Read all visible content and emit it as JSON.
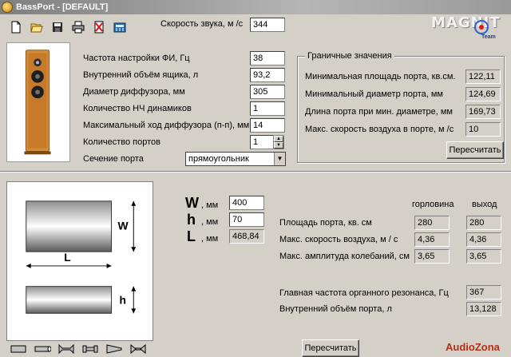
{
  "window": {
    "title": "BassPort - [DEFAULT]"
  },
  "brand": {
    "logo_text": "MAGNIT",
    "logo_sub": "Team"
  },
  "toolbar": {
    "icons": [
      "new-file-icon",
      "open-folder-icon",
      "save-icon",
      "print-icon",
      "delete-icon",
      "calculator-icon"
    ]
  },
  "sound_speed": {
    "label": "Скорость звука, м /с",
    "value": "344"
  },
  "params": [
    {
      "label": "Частота настройки ФИ, Гц",
      "value": "38"
    },
    {
      "label": "Внутренний объём ящика, л",
      "value": "93,2"
    },
    {
      "label": "Диаметр диффузора, мм",
      "value": "305"
    },
    {
      "label": "Количество НЧ динамиков",
      "value": "1"
    },
    {
      "label": "Максимальный ход диффузора (п-п), мм",
      "value": "14"
    },
    {
      "label": "Количество портов",
      "value": "1"
    }
  ],
  "port_section": {
    "label": "Сечение порта",
    "value": "прямоугольник"
  },
  "limits": {
    "title": "Граничные значения",
    "rows": [
      {
        "label": "Минимальная площадь порта, кв.см.",
        "value": "122,11"
      },
      {
        "label": "Минимальный диаметр порта, мм",
        "value": "124,69"
      },
      {
        "label": "Длина порта при мин. диаметре, мм",
        "value": "169,73"
      },
      {
        "label": "Макс. скорость воздуха в порте, м /с",
        "value": "10"
      }
    ],
    "recalc_label": "Пересчитать"
  },
  "dimensions": {
    "w": {
      "symbol": "W",
      "unit": ", мм",
      "value": "400"
    },
    "h": {
      "symbol": "h",
      "unit": ", мм",
      "value": "70"
    },
    "l": {
      "symbol": "L",
      "unit": ", мм",
      "value": "468,84"
    }
  },
  "results": {
    "col_throat": "горловина",
    "col_exit": "выход",
    "rows": [
      {
        "label": "Площадь порта, кв. см",
        "throat": "280",
        "exit": "280"
      },
      {
        "label": "Макс. скорость воздуха, м / с",
        "throat": "4,36",
        "exit": "4,36"
      },
      {
        "label": "Макс. амплитуда колебаний, см",
        "throat": "3,65",
        "exit": "3,65"
      }
    ],
    "organ_label": "Главная частота органного резонанса, Гц",
    "organ_value": "367",
    "volume_label": "Внутренний объём порта, л",
    "volume_value": "13,128"
  },
  "diagram": {
    "w_label": "W",
    "l_label": "L",
    "h_label": "h"
  },
  "bottom": {
    "recalc_label": "Пересчитать",
    "footer_brand": "AudioZona"
  },
  "colors": {
    "titlebar": "#9a9a9a",
    "face": "#d4d0c8",
    "brand_red": "#b42d18",
    "ring_blue": "#2c5fd6"
  }
}
